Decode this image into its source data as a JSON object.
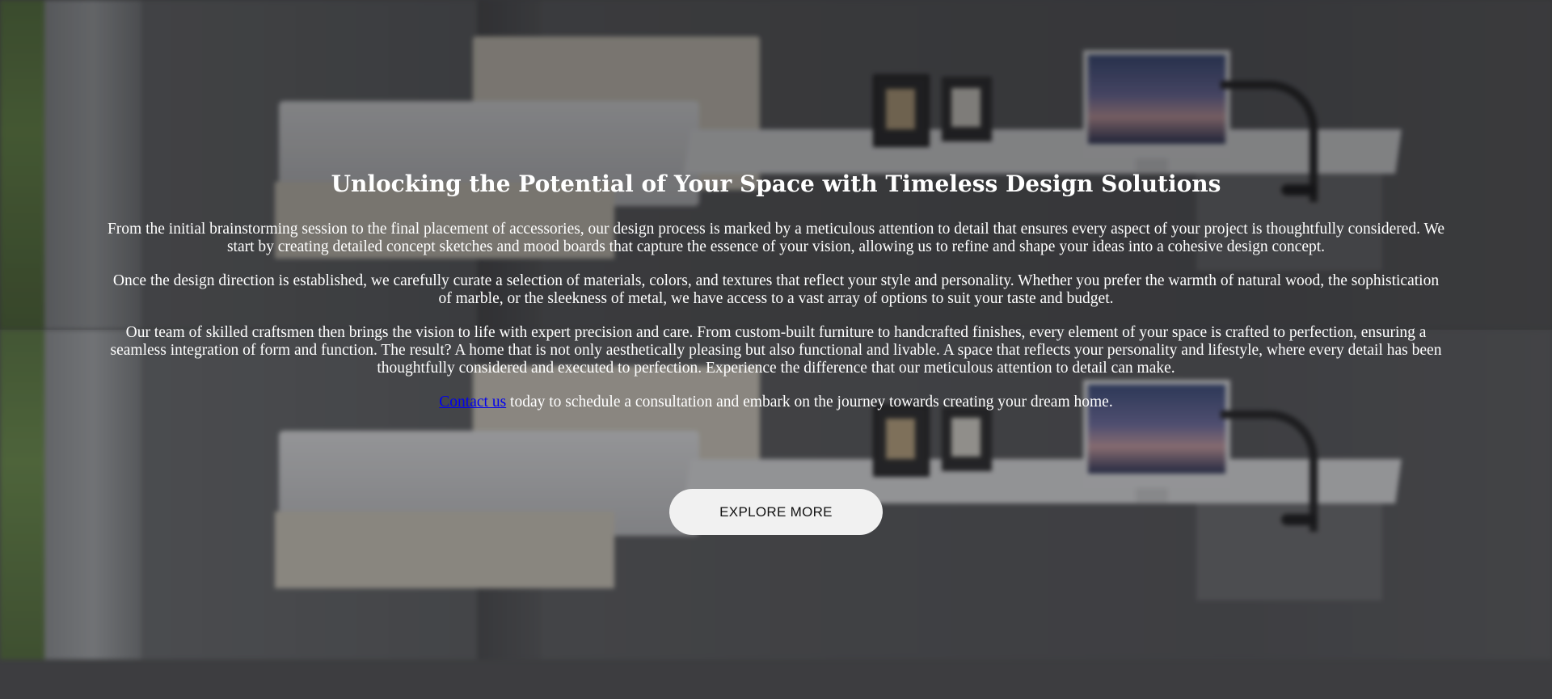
{
  "hero": {
    "title": "Unlocking the Potential of Your Space with Timeless Design Solutions",
    "paragraphs": [
      "From the initial brainstorming session to the final placement of accessories, our design process is marked by a meticulous attention to detail that ensures every aspect of your project is thoughtfully considered. We start by creating detailed concept sketches and mood boards that capture the essence of your vision, allowing us to refine and shape your ideas into a cohesive design concept.",
      "Once the design direction is established, we carefully curate a selection of materials, colors, and textures that reflect your style and personality. Whether you prefer the warmth of natural wood, the sophistication of marble, or the sleekness of metal, we have access to a vast array of options to suit your taste and budget.",
      "Our team of skilled craftsmen then brings the vision to life with expert precision and care. From custom-built furniture to handcrafted finishes, every element of your space is crafted to perfection, ensuring a seamless integration of form and function. The result? A home that is not only aesthetically pleasing but also functional and livable. A space that reflects your personality and lifestyle, where every detail has been thoughtfully considered and executed to perfection. Experience the difference that our meticulous attention to detail can make."
    ],
    "contact": {
      "link_label": "Contact us",
      "text": " today to schedule a consultation and embark on the journey towards creating your dream home."
    },
    "button_label": "EXPLORE MORE"
  },
  "colors": {
    "text": "#ffffff",
    "link": "#0000ee",
    "button_bg": "#f1f1f1",
    "button_text": "#111111"
  }
}
